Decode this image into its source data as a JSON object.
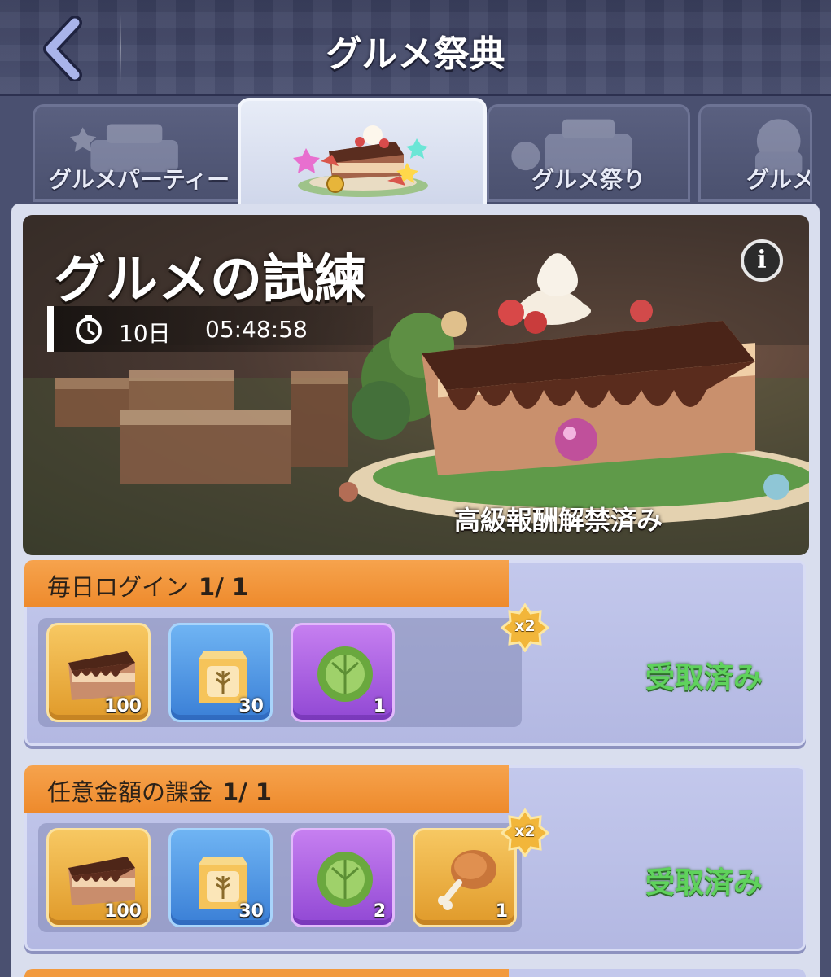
{
  "header": {
    "title": "グルメ祭典",
    "back_icon": "chevron-left-icon"
  },
  "tabs": [
    {
      "label": "グルメパーティー",
      "active": false
    },
    {
      "label": "",
      "active": true
    },
    {
      "label": "グルメ祭り",
      "active": false
    },
    {
      "label": "グルメ",
      "active": false
    }
  ],
  "banner": {
    "title": "グルメの試練",
    "timer_days": "10日",
    "timer_time": "05:48:58",
    "status": "高級報酬解禁済み",
    "info_label": "i"
  },
  "tasks": [
    {
      "title": "毎日ログイン",
      "progress": "1/ 1",
      "multiplier": "x2",
      "status": "受取済み",
      "rewards": [
        {
          "icon": "cake-slice-icon",
          "count": "100",
          "color": "gold"
        },
        {
          "icon": "flour-bag-icon",
          "count": "30",
          "color": "blue"
        },
        {
          "icon": "cabbage-icon",
          "count": "1",
          "color": "purple"
        }
      ]
    },
    {
      "title": "任意金額の課金",
      "progress": "1/ 1",
      "multiplier": "x2",
      "status": "受取済み",
      "rewards": [
        {
          "icon": "cake-slice-icon",
          "count": "100",
          "color": "gold"
        },
        {
          "icon": "flour-bag-icon",
          "count": "30",
          "color": "blue"
        },
        {
          "icon": "cabbage-icon",
          "count": "2",
          "color": "purple"
        },
        {
          "icon": "chicken-leg-icon",
          "count": "1",
          "color": "gold"
        }
      ]
    }
  ],
  "colors": {
    "accent_orange": "#f29a3e",
    "claimed_green": "#5fd25c",
    "panel_lavender": "#c3c8ec"
  }
}
